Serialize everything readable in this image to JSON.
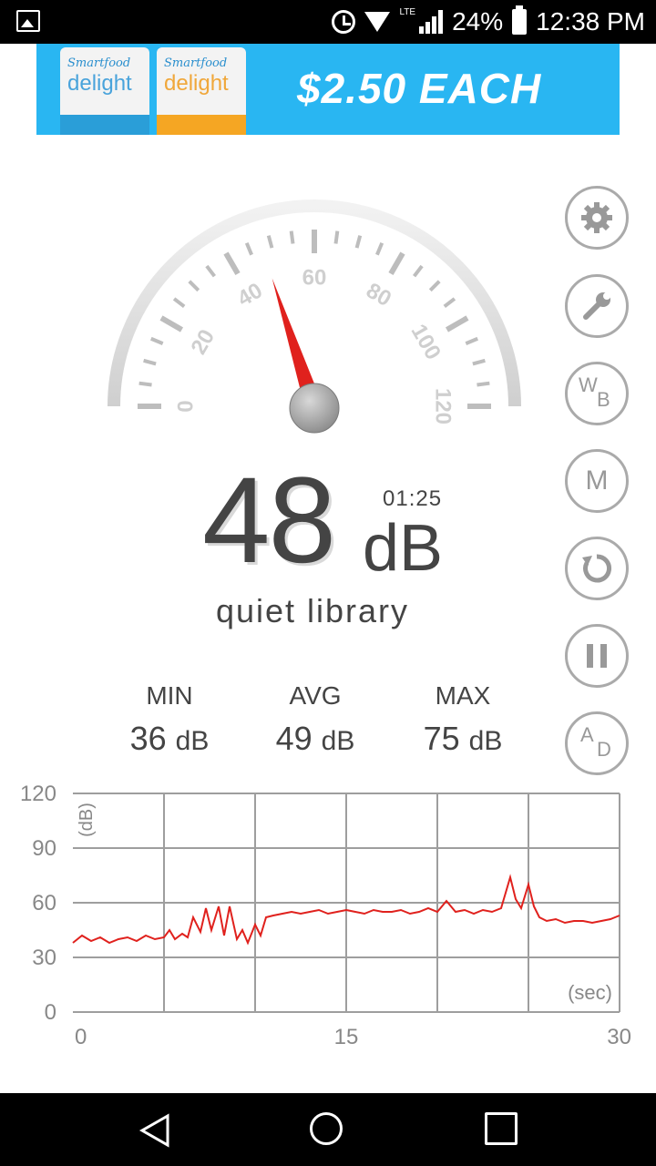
{
  "status_bar": {
    "battery": "24%",
    "time": "12:38 PM",
    "network": "LTE"
  },
  "ad": {
    "product_brand": "Smartfood",
    "product_name": "delight",
    "price_text": "$2.50 EACH",
    "bag_colors": [
      "#2a9ed8",
      "#f5a623"
    ]
  },
  "meter": {
    "value": 48,
    "value_text": "48",
    "unit": "dB",
    "timer": "01:25",
    "description": "quiet library",
    "gauge_min": 0,
    "gauge_max": 120,
    "gauge_labels": [
      "0",
      "20",
      "40",
      "60",
      "80",
      "100",
      "120"
    ],
    "needle_color": "#e0211d"
  },
  "stats": {
    "min_label": "MIN",
    "min_value": "36",
    "min_unit": "dB",
    "avg_label": "AVG",
    "avg_value": "49",
    "avg_unit": "dB",
    "max_label": "MAX",
    "max_value": "75",
    "max_unit": "dB"
  },
  "side_buttons": [
    {
      "icon": "gear-icon"
    },
    {
      "icon": "wrench-icon"
    },
    {
      "icon": "white-balance-icon",
      "text": "W",
      "sub": "B"
    },
    {
      "icon": "m-icon",
      "text": "M"
    },
    {
      "icon": "reset-icon"
    },
    {
      "icon": "pause-icon"
    },
    {
      "icon": "ad-icon",
      "text": "A",
      "sub": "D"
    }
  ],
  "chart_data": {
    "type": "line",
    "ylabel": "(dB)",
    "xlabel": "(sec)",
    "xlim": [
      0,
      30
    ],
    "ylim": [
      0,
      120
    ],
    "x_ticks": [
      "0",
      "15",
      "30"
    ],
    "y_ticks": [
      "0",
      "30",
      "60",
      "90",
      "120"
    ],
    "grid": true,
    "line_color": "#e0211d",
    "x": [
      0,
      0.5,
      1,
      1.5,
      2,
      2.5,
      3,
      3.5,
      4,
      4.5,
      5,
      5.3,
      5.6,
      6,
      6.3,
      6.6,
      7,
      7.3,
      7.6,
      8,
      8.3,
      8.6,
      9,
      9.3,
      9.6,
      10,
      10.3,
      10.6,
      11,
      11.5,
      12,
      12.5,
      13,
      13.5,
      14,
      14.5,
      15,
      15.5,
      16,
      16.5,
      17,
      17.5,
      18,
      18.5,
      19,
      19.5,
      20,
      20.5,
      21,
      21.5,
      22,
      22.5,
      23,
      23.5,
      24,
      24.3,
      24.6,
      25,
      25.3,
      25.6,
      26,
      26.5,
      27,
      27.5,
      28,
      28.5,
      29,
      29.5,
      30
    ],
    "y": [
      38,
      42,
      39,
      41,
      38,
      40,
      41,
      39,
      42,
      40,
      41,
      45,
      40,
      43,
      41,
      52,
      44,
      57,
      45,
      58,
      42,
      58,
      40,
      45,
      38,
      48,
      42,
      52,
      53,
      54,
      55,
      54,
      55,
      56,
      54,
      55,
      56,
      55,
      54,
      56,
      55,
      55,
      56,
      54,
      55,
      57,
      55,
      61,
      55,
      56,
      54,
      56,
      55,
      57,
      74,
      62,
      57,
      70,
      58,
      52,
      50,
      51,
      49,
      50,
      50,
      49,
      50,
      51,
      53
    ]
  }
}
